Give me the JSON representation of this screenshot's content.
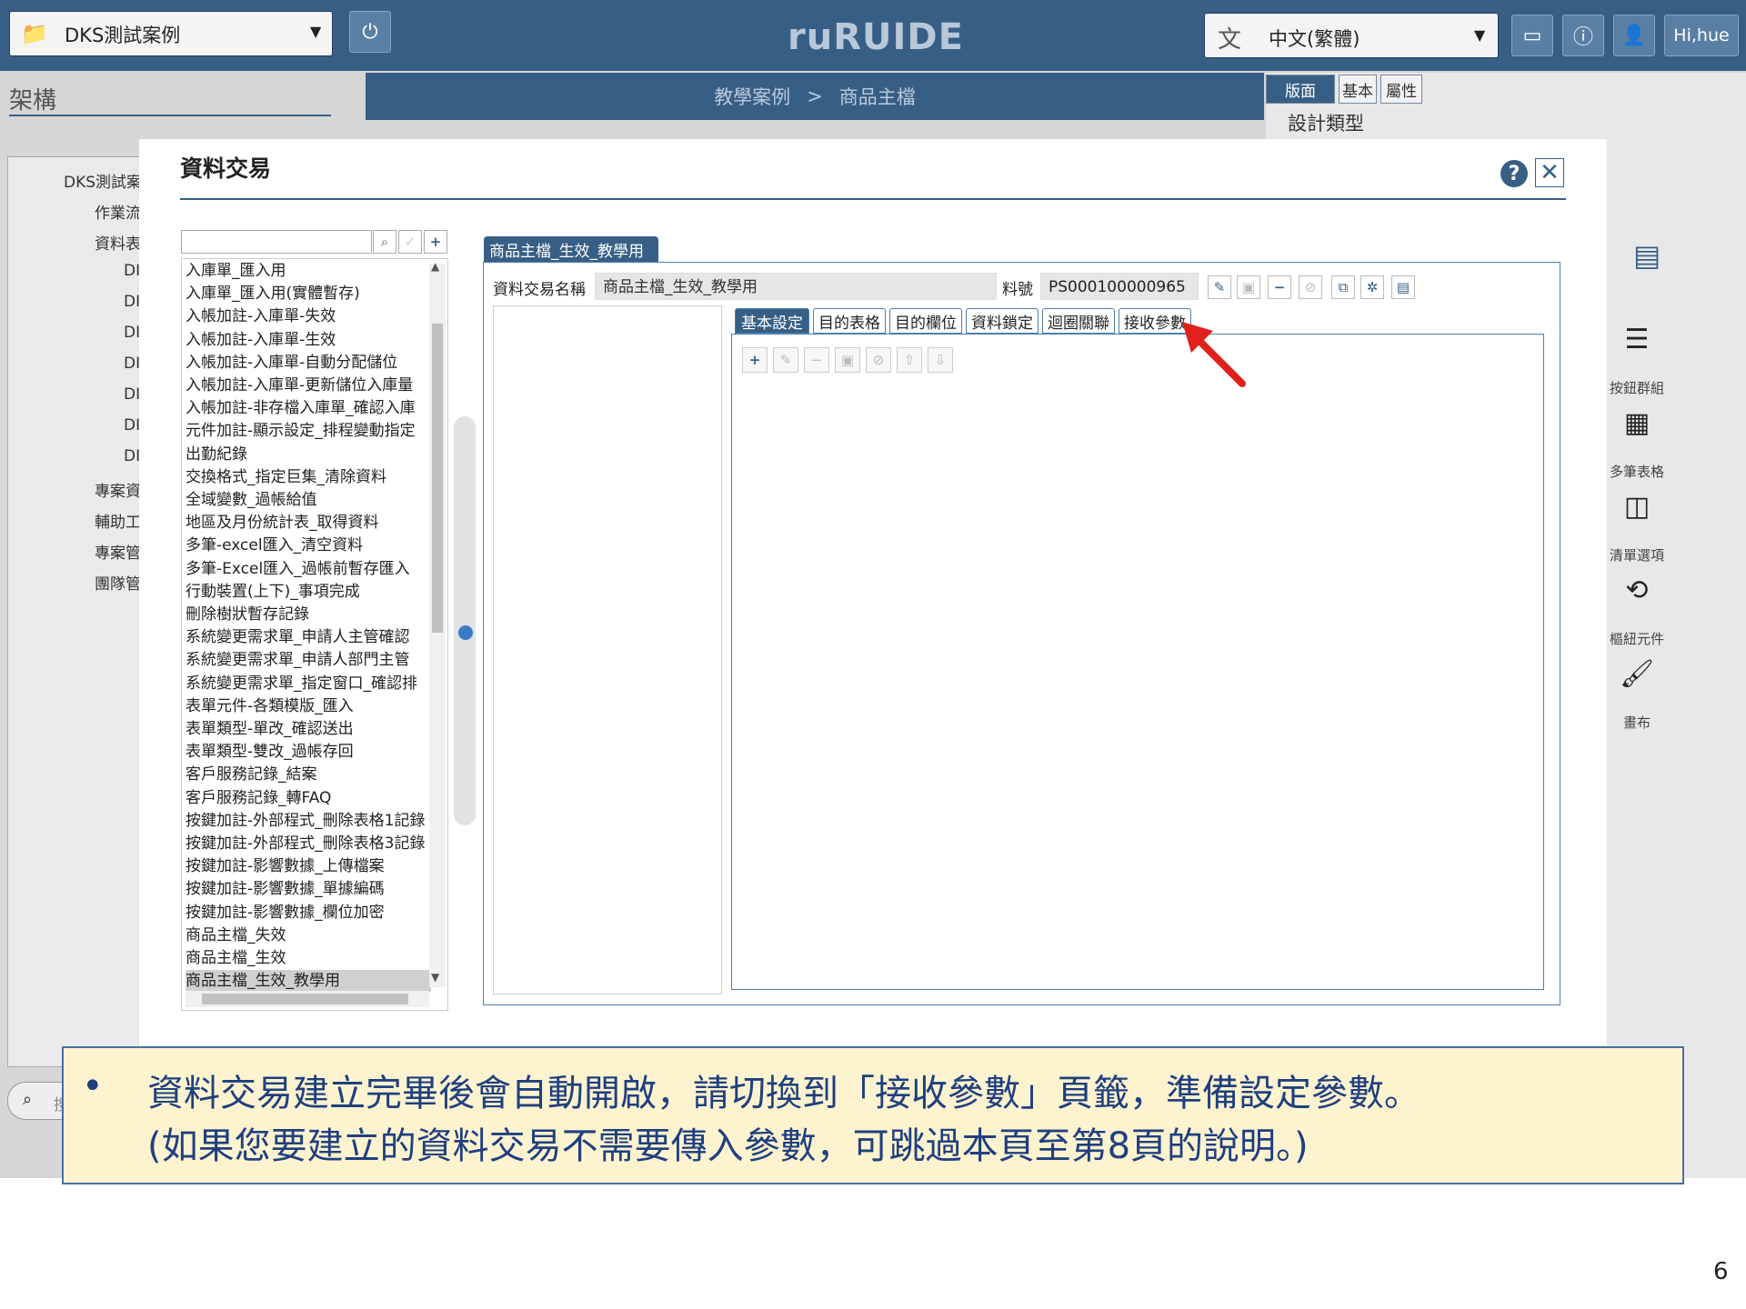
{
  "topbar": {
    "project_select": "DKS測試案例",
    "logo": "ruRUIDE",
    "language_select": "中文(繁體)",
    "user_greeting": "Hi,hue"
  },
  "sidebar": {
    "title": "架構",
    "tree": [
      "DKS測試案",
      "作業流",
      "資料表",
      "DI",
      "DI",
      "DI",
      "DI",
      "DI",
      "DI",
      "DI",
      "專案資",
      "輔助工",
      "專案管",
      "團隊管"
    ],
    "search_placeholder": "搜"
  },
  "breadcrumb": {
    "parent": "教學案例",
    "separator": ">",
    "current": "商品主檔"
  },
  "right_panel": {
    "tabs": [
      "版面",
      "基本",
      "屬性"
    ],
    "section_title": "設計類型",
    "tools": [
      {
        "icon": "button-group-icon",
        "label": "按鈕群組"
      },
      {
        "icon": "table-icon",
        "label": "多筆表格"
      },
      {
        "icon": "list-option-icon",
        "label": "清單選項"
      },
      {
        "icon": "widget-icon",
        "label": "樞紐元件"
      },
      {
        "icon": "brush-icon",
        "label": "畫布"
      }
    ]
  },
  "modal": {
    "title": "資料交易",
    "help_label": "?",
    "close_label": "✕",
    "search_placeholder": "",
    "list_items": [
      "入庫單_匯入用",
      "入庫單_匯入用(實體暫存)",
      "入帳加註-入庫單-失效",
      "入帳加註-入庫單-生效",
      "入帳加註-入庫單-自動分配儲位",
      "入帳加註-入庫單-更新儲位入庫量",
      "入帳加註-非存檔入庫單_確認入庫",
      "元件加註-顯示設定_排程變動指定",
      "出勤紀錄",
      "交換格式_指定巨集_清除資料",
      "全域變數_過帳給值",
      "地區及月份統計表_取得資料",
      "多筆-excel匯入_清空資料",
      "多筆-Excel匯入_過帳前暫存匯入",
      "行動裝置(上下)_事項完成",
      "刪除樹狀暫存記錄",
      "系統變更需求單_申請人主管確認",
      "系統變更需求單_申請人部門主管",
      "系統變更需求單_指定窗口_確認排",
      "表單元件-各類模版_匯入",
      "表單類型-單改_確認送出",
      "表單類型-雙改_過帳存回",
      "客戶服務記錄_結案",
      "客戶服務記錄_轉FAQ",
      "按鍵加註-外部程式_刪除表格1記錄",
      "按鍵加註-外部程式_刪除表格3記錄",
      "按鍵加註-影響數據_上傳檔案",
      "按鍵加註-影響數據_單據編碼",
      "按鍵加註-影響數據_欄位加密",
      "商品主檔_失效",
      "商品主檔_生效",
      "商品主檔_生效_教學用"
    ],
    "selected_index": 31,
    "detail": {
      "tab_label": "商品主檔_生效_教學用",
      "name_label": "資料交易名稱",
      "name_value": "商品主檔_生效_教學用",
      "number_label": "料號",
      "number_value": "PS000100000965",
      "inner_tabs": [
        "基本設定",
        "目的表格",
        "目的欄位",
        "資料鎖定",
        "迴圈關聯",
        "接收參數"
      ],
      "active_tab": "基本設定"
    }
  },
  "note": {
    "bullet": "•",
    "line1": "資料交易建立完畢後會自動開啟，請切換到「接收參數」頁籤，準備設定參數。",
    "line2": "(如果您要建立的資料交易不需要傳入參數，可跳過本頁至第8頁的說明。)"
  },
  "page_number": "6",
  "colors": {
    "primary": "#375f86",
    "note_bg": "#fdf3cf",
    "note_text": "#1f3f7f",
    "arrow": "#e0201a"
  }
}
